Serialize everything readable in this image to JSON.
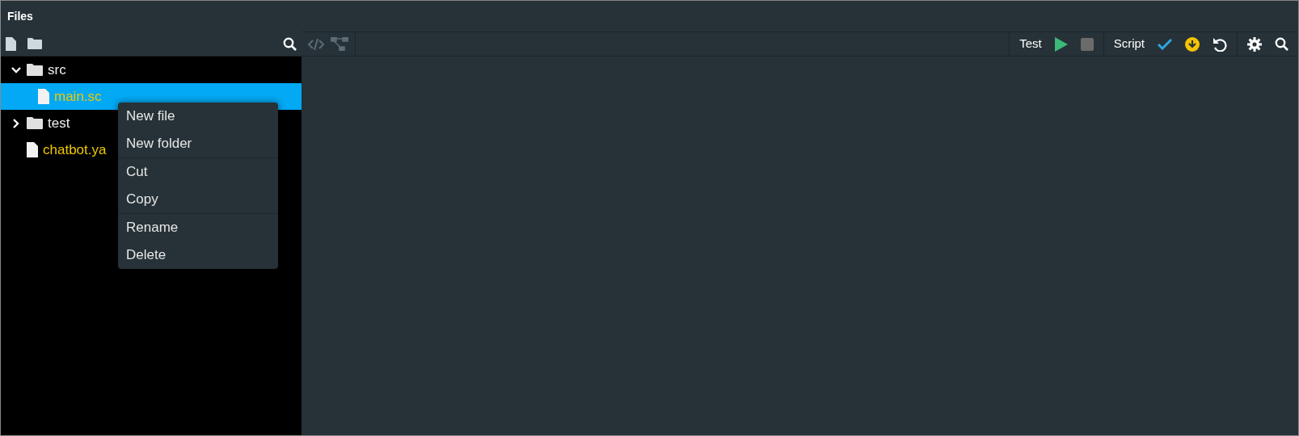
{
  "panel": {
    "title": "Files"
  },
  "tree": [
    {
      "label": "src",
      "kind": "folder",
      "expanded": true,
      "selected": false,
      "children": [
        {
          "label": "main.sc",
          "kind": "file",
          "selected": true
        }
      ]
    },
    {
      "label": "test",
      "kind": "folder",
      "expanded": false,
      "selected": false
    },
    {
      "label": "chatbot.ya",
      "kind": "file",
      "selected": false
    }
  ],
  "editor_toolbar": {
    "tools": [
      {
        "kind": "code",
        "disabled": true
      },
      {
        "kind": "tree",
        "disabled": true
      }
    ],
    "actions": [
      {
        "kind": "label",
        "text": "Test"
      },
      {
        "kind": "play"
      },
      {
        "kind": "stop"
      },
      {
        "kind": "sep"
      },
      {
        "kind": "label",
        "text": "Script"
      },
      {
        "kind": "check"
      },
      {
        "kind": "download"
      },
      {
        "kind": "undo"
      },
      {
        "kind": "sep"
      },
      {
        "kind": "gear"
      },
      {
        "kind": "search"
      }
    ]
  },
  "context_menu": {
    "groups": [
      [
        "New file",
        "New folder"
      ],
      [
        "Cut",
        "Copy"
      ],
      [
        "Rename",
        "Delete"
      ]
    ]
  }
}
